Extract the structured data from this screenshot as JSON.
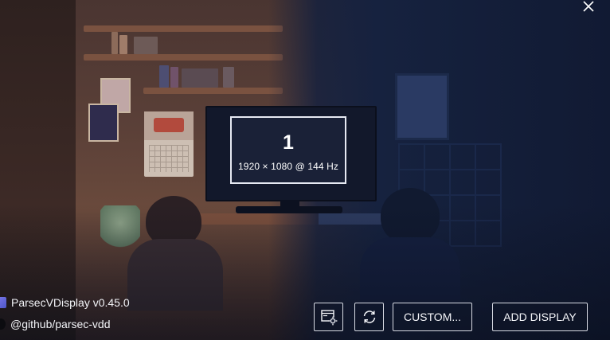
{
  "window": {
    "close_icon": "close-icon"
  },
  "display": {
    "number": "1",
    "resolution": "1920 × 1080 @ 144 Hz"
  },
  "app_info": {
    "name_version": "ParsecVDisplay v0.45.0",
    "github": "@github/parsec-vdd",
    "app_icon": "app-icon",
    "github_icon": "github-icon"
  },
  "toolbar": {
    "display_settings_icon": "display-settings-icon",
    "refresh_icon": "refresh-icon",
    "custom_label": "CUSTOM...",
    "add_display_label": "ADD DISPLAY"
  },
  "colors": {
    "text": "#f2f3f7",
    "button_border": "#d7dae3",
    "display_border": "#e6e9f2",
    "background_cool": "#16223f",
    "background_warm": "#5b4038"
  }
}
